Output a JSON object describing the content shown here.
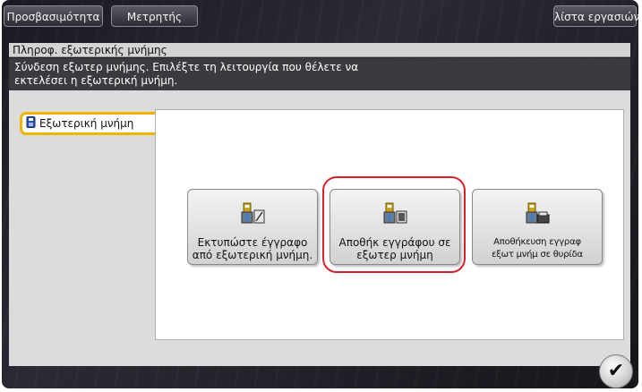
{
  "topbar": {
    "accessibility_label": "Προσβασιμότητα",
    "counter_label": "Μετρητής",
    "joblist_label": "λίστα εργασιών"
  },
  "screen": {
    "title": "Πληροφ. εξωτερικής μνήμης",
    "message_line1": "Σύνδεση εξωτερ μνήμης. Επιλέξτε τη λειτουργία που θέλετε να",
    "message_line2": "εκτελέσει η εξωτερική μνήμη."
  },
  "sidebar": {
    "tab_label": "Εξωτερική μνήμη",
    "tab_icon": "usb-memory-icon"
  },
  "functions": [
    {
      "label_line1": "Εκτυπώστε έγγραφο",
      "label_line2": "από εξωτερική μνήμη.",
      "icon": "print-from-memory-icon"
    },
    {
      "label_line1": "Αποθήκ εγγράφου σε",
      "label_line2": "εξωτερ μνήμη",
      "icon": "save-to-memory-icon"
    },
    {
      "label_line1": "Αποθήκευση εγγραφ",
      "label_line2": "εξωτ μνήμ σε θυρίδα",
      "icon": "save-to-box-icon"
    }
  ],
  "ok_icon": "checkmark-icon",
  "colors": {
    "highlight": "#d8212b",
    "tab_accent": "#f0b400"
  }
}
